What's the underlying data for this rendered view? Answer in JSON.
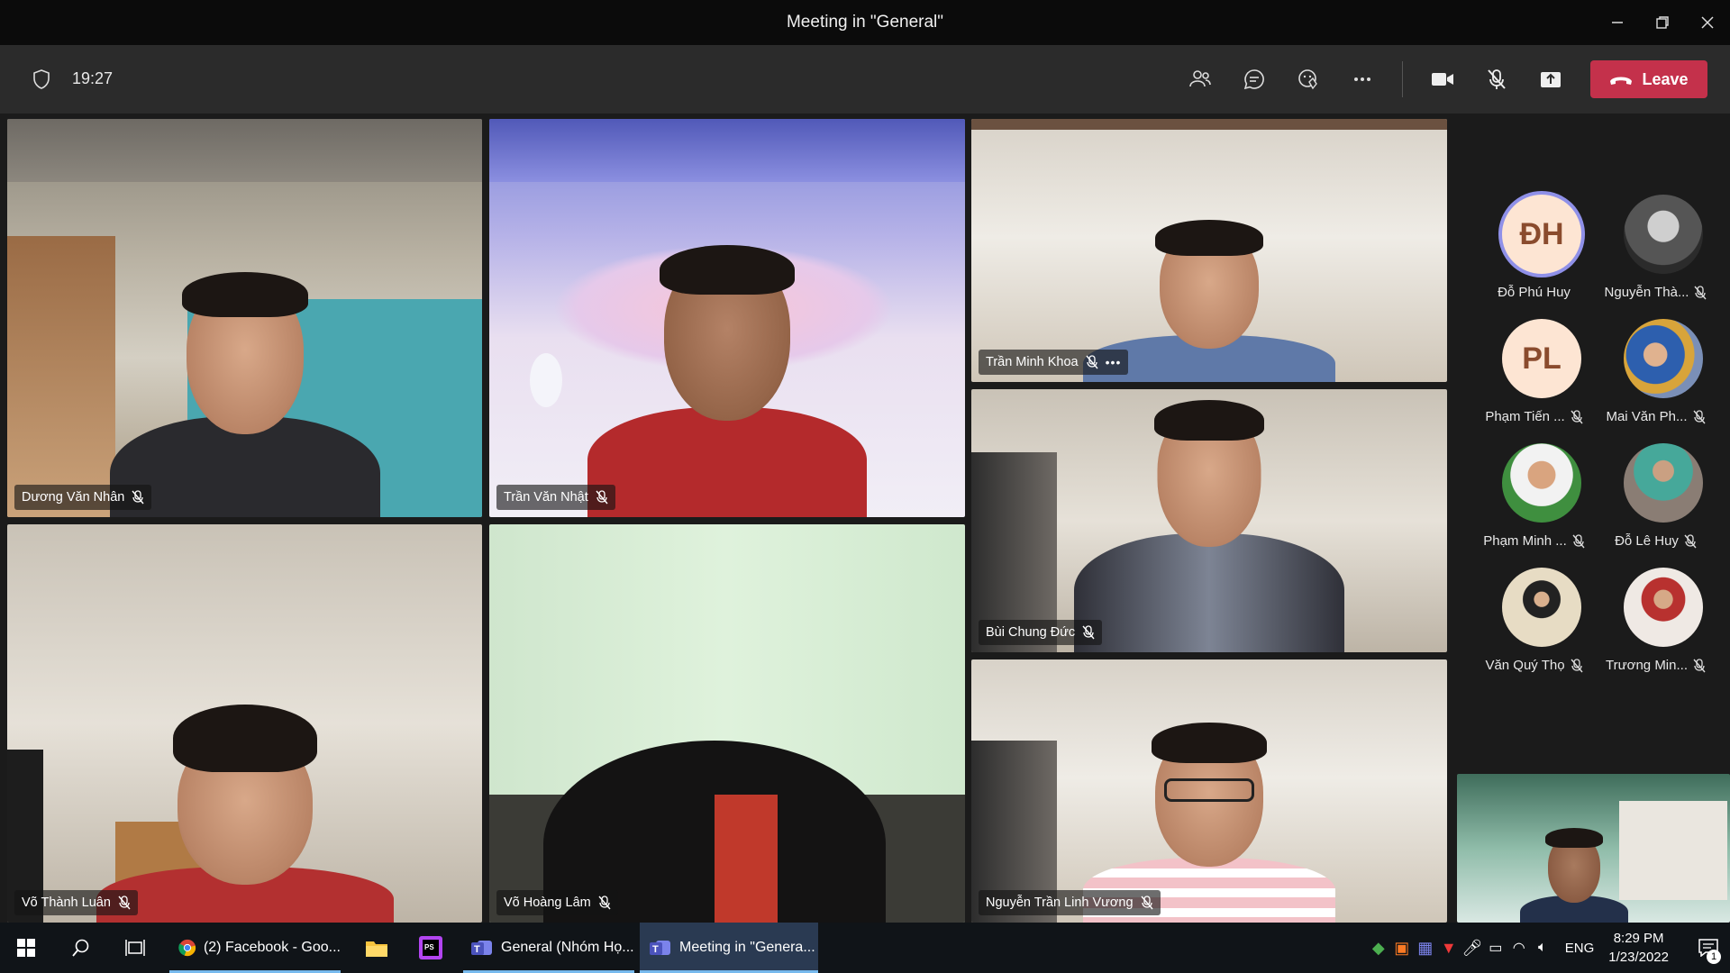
{
  "window": {
    "title": "Meeting in \"General\""
  },
  "toolbar": {
    "timer": "19:27",
    "leave_label": "Leave",
    "icons": [
      "people-icon",
      "chat-icon",
      "reactions-icon",
      "more-icon",
      "camera-icon",
      "mic-off-icon",
      "share-icon"
    ]
  },
  "tiles": [
    {
      "name": "Dương Văn Nhân"
    },
    {
      "name": "Trần Văn Nhật"
    },
    {
      "name": "Trần Minh Khoa"
    },
    {
      "name": "Bùi Chung Đức"
    },
    {
      "name": "Võ Thành Luân"
    },
    {
      "name": "Võ Hoàng Lâm"
    },
    {
      "name": "Nguyễn Trần Linh Vương"
    }
  ],
  "roster": [
    {
      "name": "Đỗ Phú Huy",
      "initials": "ĐH",
      "muted": false
    },
    {
      "name": "Nguyễn Thà...",
      "initials": "",
      "muted": true
    },
    {
      "name": "Phạm Tiến ...",
      "initials": "PL",
      "muted": true
    },
    {
      "name": "Mai Văn Ph...",
      "initials": "",
      "muted": true
    },
    {
      "name": "Phạm Minh ...",
      "initials": "",
      "muted": true
    },
    {
      "name": "Đỗ Lê Huy",
      "initials": "",
      "muted": true
    },
    {
      "name": "Văn Quý Thọ",
      "initials": "",
      "muted": true
    },
    {
      "name": "Trương Min...",
      "initials": "",
      "muted": true
    }
  ],
  "taskbar": {
    "items": [
      {
        "label": "(2) Facebook - Goo..."
      },
      {
        "label": "General (Nhóm Họ..."
      },
      {
        "label": "Meeting in \"Genera..."
      }
    ],
    "language": "ENG",
    "time": "8:29 PM",
    "date": "1/23/2022",
    "notification_count": "1"
  },
  "colors": {
    "leave": "#c4314b",
    "ring": "#8f90e8",
    "taskbar_active": "#2a3a52"
  }
}
